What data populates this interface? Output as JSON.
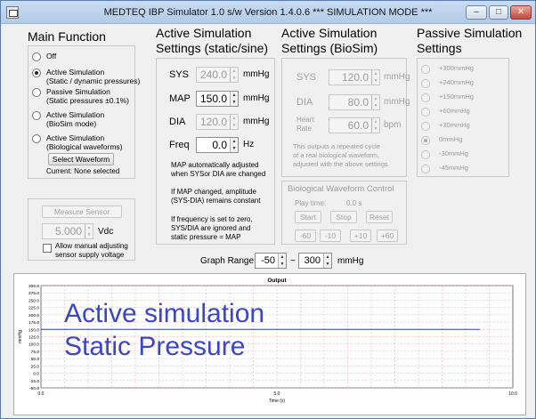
{
  "window": {
    "title": "MEDTEQ IBP Simulator  1.0     s/w Version 1.4.0.6      *** SIMULATION MODE ***",
    "min_glyph": "–",
    "max_glyph": "□",
    "close_glyph": "✕"
  },
  "main_function": {
    "title": "Main Function",
    "options": [
      {
        "label": "Off",
        "selected": false
      },
      {
        "label": "Active Simulation\n(Static / dynamic pressures)",
        "selected": true
      },
      {
        "label": "Passive Simulation\n(Static pressures ±0.1%)",
        "selected": false
      },
      {
        "label": "Active Simulation\n(BioSim mode)",
        "selected": false
      },
      {
        "label": "Active Simulation\n(Biological waveforms)",
        "selected": false
      }
    ],
    "select_waveform_label": "Select Waveform",
    "current_selection": "Current: None selected"
  },
  "sensor": {
    "measure_label": "Measure Sensor",
    "value": "5.000",
    "unit": "Vdc",
    "allow_label": "Allow manual adjusting\nsensor supply voltage"
  },
  "active_static": {
    "title": "Active Simulation\nSettings (static/sine)",
    "rows": [
      {
        "label": "SYS",
        "value": "240.0",
        "unit": "mmHg",
        "enabled": false
      },
      {
        "label": "MAP",
        "value": "150.0",
        "unit": "mmHg",
        "enabled": true
      },
      {
        "label": "DIA",
        "value": "120.0",
        "unit": "mmHg",
        "enabled": false
      },
      {
        "label": "Freq",
        "value": "0.0",
        "unit": "Hz",
        "enabled": true
      }
    ],
    "notes": [
      "MAP automatically adjusted\nwhen SYSor DIA are changed",
      "If MAP changed, amplitude\n(SYS-DIA) remains constant",
      "If frequency is set to zero,\nSYS/DIA are ignored and\nstatic pressure = MAP"
    ]
  },
  "active_biosim": {
    "title": "Active Simulation\nSettings (BioSim)",
    "sys": {
      "label": "SYS",
      "value": "120.0",
      "unit": "mmHg"
    },
    "dia": {
      "label": "DIA",
      "value": "80.0",
      "unit": "mmHg"
    },
    "hr": {
      "label": "Heart\nRate",
      "value": "60.0",
      "unit": "bpm"
    },
    "note": "This outputs a repeated cycle\nof a real biological waveform,\nadjusted with the above settings"
  },
  "bio_control": {
    "title": "Biological Waveform Control",
    "play_time_label": "Play time:",
    "play_time_value": "0.0 s",
    "start": "Start",
    "stop": "Stop",
    "reset": "Reset",
    "steps": [
      "-60",
      "-10",
      "+10",
      "+60"
    ]
  },
  "passive": {
    "title": "Passive Simulation\nSettings",
    "options": [
      {
        "label": "+300mmHg",
        "selected": false
      },
      {
        "label": "+240mmHg",
        "selected": false
      },
      {
        "label": "+150mmHg",
        "selected": false
      },
      {
        "label": "+60mmHg",
        "selected": false
      },
      {
        "label": "+30mmHg",
        "selected": false
      },
      {
        "label": "0mmHg",
        "selected": true
      },
      {
        "label": "-30mmHg",
        "selected": false
      },
      {
        "label": "-45mmHg",
        "selected": false
      }
    ]
  },
  "graph_range": {
    "label": "Graph Range:",
    "min": "-50",
    "separator": "~",
    "max": "300",
    "unit": "mmHg"
  },
  "chart_data": {
    "type": "line",
    "title": "Output",
    "xlabel": "Time (s)",
    "ylabel": "mmHg",
    "xlim": [
      0,
      10
    ],
    "ylim": [
      -50,
      300
    ],
    "x_ticks": [
      0,
      5,
      10
    ],
    "x_tick_labels": [
      "0.0",
      "5.0",
      "10.0"
    ],
    "y_ticks": [
      300,
      275,
      250,
      225,
      200,
      175,
      150,
      125,
      100,
      75,
      50,
      25,
      0,
      -25,
      -50
    ],
    "y_tick_labels": [
      "300.0",
      "275.0",
      "250.0",
      "225.0",
      "200.0",
      "175.0",
      "150.0",
      "125.0",
      "100.0",
      "75.0",
      "50.0",
      "25.0",
      "0.0",
      "-25.0",
      "-50.0"
    ],
    "grid": true,
    "series": [
      {
        "x": [
          0,
          9.3
        ],
        "values": [
          150,
          150
        ],
        "color": "#2b3bbf"
      }
    ],
    "overlay_text": [
      "Active simulation",
      "Static Pressure"
    ],
    "overlay_color": "#3a46c8",
    "grid_color": "#f0a0b0",
    "line_color": "#2b3bbf"
  }
}
